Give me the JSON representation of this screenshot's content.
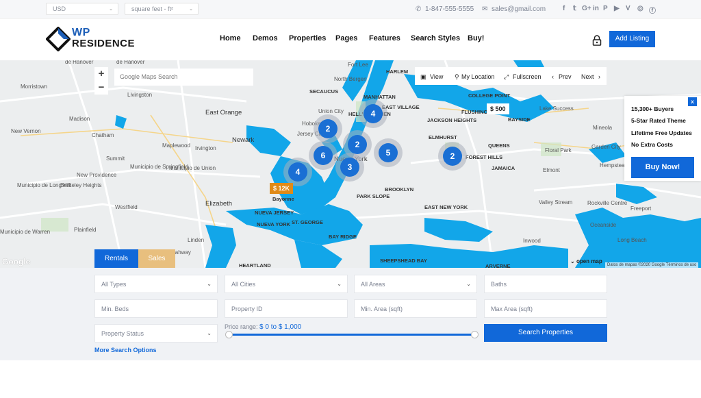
{
  "topbar": {
    "currency": "USD",
    "area_unit": "square feet - ft²",
    "phone": "1-847-555-5555",
    "email": "sales@gmail.com",
    "social_icons": [
      "facebook-icon",
      "twitter-icon",
      "google-plus-icon",
      "linkedin-icon",
      "pinterest-icon",
      "youtube-icon",
      "vimeo-icon",
      "instagram-icon",
      "foursquare-icon"
    ],
    "social_glyphs": [
      "f",
      "𝕥",
      "G+",
      "in",
      "P",
      "▶",
      "V",
      "◎",
      "ⓕ"
    ]
  },
  "header": {
    "logo_line1": "WP",
    "logo_line2": "RESIDENCE",
    "nav": [
      "Home",
      "Demos",
      "Properties",
      "Pages",
      "Features",
      "Search Styles",
      "Buy!"
    ],
    "add_listing": "Add Listing"
  },
  "map": {
    "zoom_in": "+",
    "zoom_out": "−",
    "search_placeholder": "Google Maps Search",
    "controls": {
      "view": "View",
      "my_location": "My Location",
      "fullscreen": "Fullscreen",
      "prev": "Prev",
      "next": "Next"
    },
    "labels": [
      "de Hanover",
      "de Hanover",
      "Morristown",
      "Livingston",
      "East Orange",
      "Madison",
      "New Vernon",
      "Chatham",
      "Newark",
      "Maplewood",
      "Irvington",
      "Summit",
      "Municipio de Springfield",
      "Municipio de Union",
      "New Providence",
      "Municipio de Long Hill",
      "Berkeley Heights",
      "Westfield",
      "Elizabeth",
      "Bayonne",
      "NUEVA JERSEY",
      "NUEVA YORK",
      "ST. GEORGE",
      "Linden",
      "Rahway",
      "Plainfield",
      "Municipio de Warren",
      "North Bergen",
      "HARLEM",
      "MANHATTAN",
      "SECAUCUS",
      "HELL'S KITCHEN",
      "EAST VILLAGE",
      "Nueva York",
      "BROOKLYN",
      "PARK SLOPE",
      "BAY RIDGE",
      "HEARTLAND",
      "SHEEPSHEAD BAY",
      "EAST NEW YORK",
      "JACKSON HEIGHTS",
      "ELMHURST",
      "FLUSHING",
      "COLLEGE POINT",
      "QUEENS",
      "JAMAICA",
      "BAYSIDE",
      "Lake Success",
      "Floral Park",
      "Mineola",
      "Garden City",
      "Hempstead",
      "Elmont",
      "Valley Stream",
      "Rockville Centre",
      "Freeport",
      "Oceanside",
      "Long Beach",
      "Inwood",
      "ARVERNE",
      "Fort Lee",
      "FOREST HILLS",
      "Hoboken",
      "Jersey City",
      "Union City"
    ],
    "clusters": [
      {
        "count": "2"
      },
      {
        "count": "4"
      },
      {
        "count": "2"
      },
      {
        "count": "6"
      },
      {
        "count": "5"
      },
      {
        "count": "3"
      },
      {
        "count": "4"
      },
      {
        "count": "2"
      }
    ],
    "price_pins": [
      {
        "label": "$ 12K"
      },
      {
        "label": "$ 500"
      }
    ],
    "google_logo": "Google",
    "open_map": "open map",
    "attribution": "Datos de mapas ©2020 Google   Términos de uso"
  },
  "promo": {
    "close": "x",
    "items": [
      "15,300+ Buyers",
      "5-Star Rated Theme",
      "Lifetime Free Updates",
      "No Extra Costs"
    ],
    "buy_label": "Buy Now!"
  },
  "search": {
    "tabs": [
      "Rentals",
      "Sales"
    ],
    "fields_row1": [
      "All Types",
      "All Cities",
      "All Areas",
      "Baths"
    ],
    "fields_row2": [
      "Min. Beds",
      "Property ID",
      "Min. Area (sqft)",
      "Max Area (sqft)"
    ],
    "property_status": "Property Status",
    "price_range_label": "Price range:",
    "price_range_value": "$ 0 to $ 1,000",
    "price_min": 0,
    "price_max": 1000,
    "search_button": "Search Properties",
    "more_options": "More Search Options"
  },
  "colors": {
    "accent": "#1168d9",
    "water": "#12a6e9",
    "sales_tab": "#e8bf7e",
    "price_pin": "#e08a17"
  }
}
